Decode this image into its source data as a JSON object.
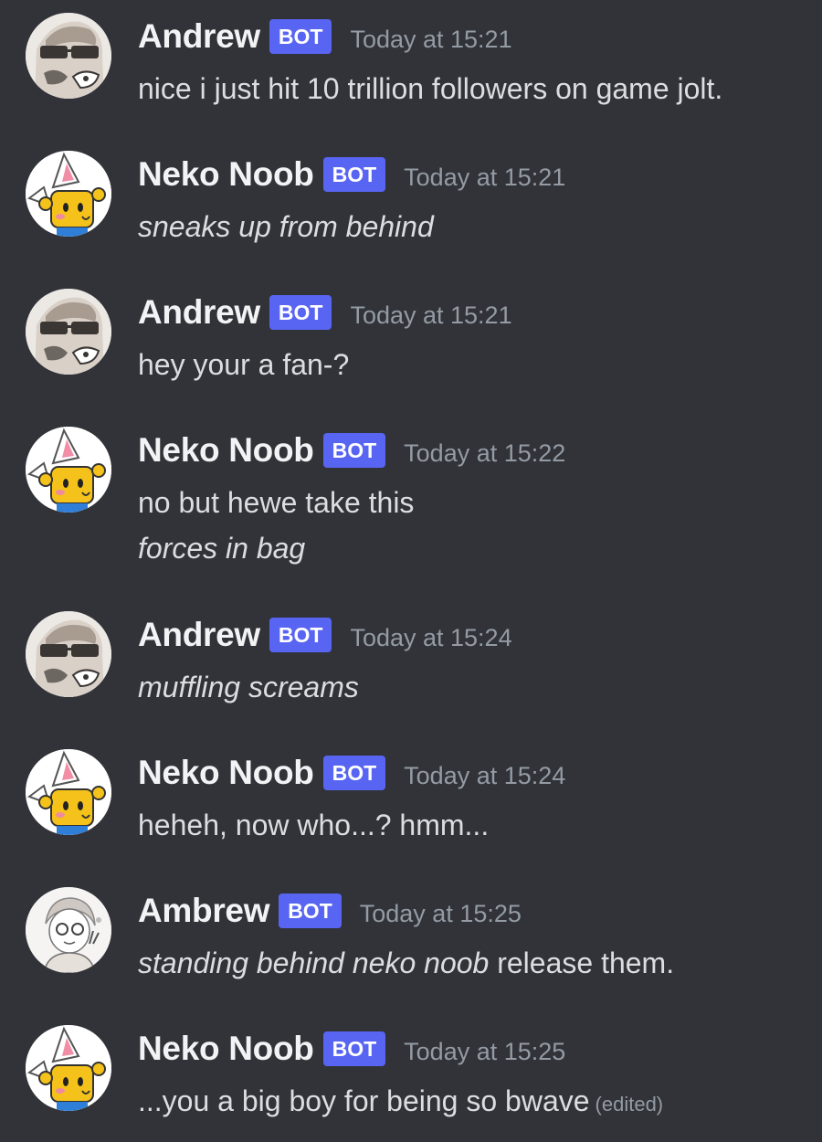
{
  "messages": [
    {
      "username": "Andrew",
      "avatar": "andrew-avatar",
      "tag": "BOT",
      "timestamp": "Today at 15:21",
      "lines": [
        {
          "plain": "nice i just hit 10 trillion followers on game jolt."
        }
      ]
    },
    {
      "username": "Neko Noob",
      "avatar": "neko-noob-avatar",
      "tag": "BOT",
      "timestamp": "Today at 15:21",
      "lines": [
        {
          "italic": "sneaks up from behind"
        }
      ]
    },
    {
      "username": "Andrew",
      "avatar": "andrew-avatar",
      "tag": "BOT",
      "timestamp": "Today at 15:21",
      "lines": [
        {
          "plain": "hey your a fan-?"
        }
      ]
    },
    {
      "username": "Neko Noob",
      "avatar": "neko-noob-avatar",
      "tag": "BOT",
      "timestamp": "Today at 15:22",
      "lines": [
        {
          "plain": "no but hewe take this"
        },
        {
          "italic": "forces in bag"
        }
      ]
    },
    {
      "username": "Andrew",
      "avatar": "andrew-avatar",
      "tag": "BOT",
      "timestamp": "Today at 15:24",
      "lines": [
        {
          "italic": "muffling screams"
        }
      ]
    },
    {
      "username": "Neko Noob",
      "avatar": "neko-noob-avatar",
      "tag": "BOT",
      "timestamp": "Today at 15:24",
      "lines": [
        {
          "plain": "heheh, now who...? hmm..."
        }
      ]
    },
    {
      "username": "Ambrew",
      "avatar": "ambrew-avatar",
      "tag": "BOT",
      "timestamp": "Today at 15:25",
      "lines": [
        {
          "italic": "standing behind neko noob",
          "plain": " release them."
        }
      ]
    },
    {
      "username": "Neko Noob",
      "avatar": "neko-noob-avatar",
      "tag": "BOT",
      "timestamp": "Today at 15:25",
      "lines": [
        {
          "plain": "...you a big boy for being so bwave",
          "edited": "(edited)"
        }
      ]
    }
  ]
}
